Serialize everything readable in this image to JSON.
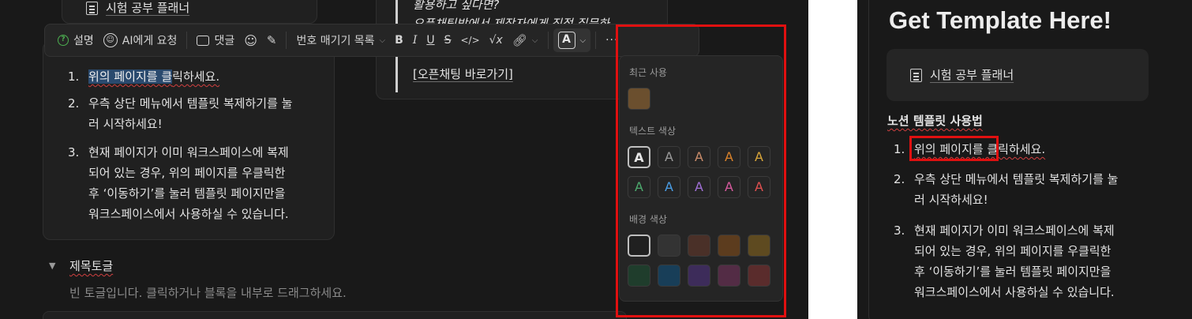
{
  "left": {
    "top_page_link": "시험 공부 플래너",
    "toolbar": {
      "explain": "설명",
      "ask_ai": "AI에게 요청",
      "comment": "댓글",
      "block_type": "번호 매기기 목록",
      "bold": "B",
      "italic": "I",
      "underline": "U",
      "strike": "S",
      "code": "</>",
      "math": "√x",
      "color_button": "A",
      "more": "···"
    },
    "list": [
      {
        "num": "1.",
        "lines": [
          "위의 페이지를 클릭하세요."
        ]
      },
      {
        "num": "2.",
        "lines": [
          "우측 상단 메뉴에서 템플릿 복제하기를 눌",
          "러 시작하세요!"
        ]
      },
      {
        "num": "3.",
        "lines": [
          "현재 페이지가 이미 워크스페이스에 복제",
          "되어 있는 경우, 위의 페이지를 우클릭한",
          "후 ‘이동하기’를 눌러 템플릿 페이지만을",
          "워크스페이스에서 사용하실 수 있습니다."
        ]
      }
    ],
    "list_item1_highlight": "위의 페이지를 클",
    "list_item1_rest": "릭하세요.",
    "callout": {
      "line1": "활용하고 싶다면?",
      "line2": "오픈채팅방에서 제작자에게 직접 질문하",
      "link": "[오픈채팅 바로가기]"
    },
    "toggle": {
      "arrow": "▼",
      "title": "제목토글",
      "placeholder": "빈 토글입니다. 클릭하거나 블록을 내부로 드래그하세요."
    },
    "palette": {
      "recent_label": "최근 사용",
      "text_color_label": "텍스트 색상",
      "bg_color_label": "배경 색상",
      "letter": "A",
      "recent_colors": [
        "#6b4f2e"
      ],
      "text_colors": [
        "#e6e6e6",
        "#9b9b9b",
        "#c98c6b",
        "#d9822b",
        "#d8a53a",
        "#4daa6e",
        "#4a9ee6",
        "#a070d6",
        "#d65a9e",
        "#e05050"
      ],
      "bg_colors": [
        "#202020",
        "#333333",
        "#4a3028",
        "#5c3c1e",
        "#5e4a20",
        "#1f3d2c",
        "#183e58",
        "#3d2c5a",
        "#532c45",
        "#5a2c2c"
      ]
    }
  },
  "right": {
    "heading": "Get Template Here!",
    "page_link": "시험 공부 플래너",
    "section_title": "노션 템플릿 사용법",
    "item1_boxed": "위의 페이지를",
    "item1_rest": " 클릭하세요.",
    "list": [
      {
        "num": "1."
      },
      {
        "num": "2.",
        "lines": [
          "우측 상단 메뉴에서 템플릿 복제하기를 눌",
          "러 시작하세요!"
        ]
      },
      {
        "num": "3.",
        "lines": [
          "현재 페이지가 이미 워크스페이스에 복제",
          "되어 있는 경우, 위의 페이지를 우클릭한",
          "후 ‘이동하기’를 눌러 템플릿 페이지만을",
          "워크스페이스에서 사용하실 수 있습니다."
        ]
      }
    ]
  }
}
